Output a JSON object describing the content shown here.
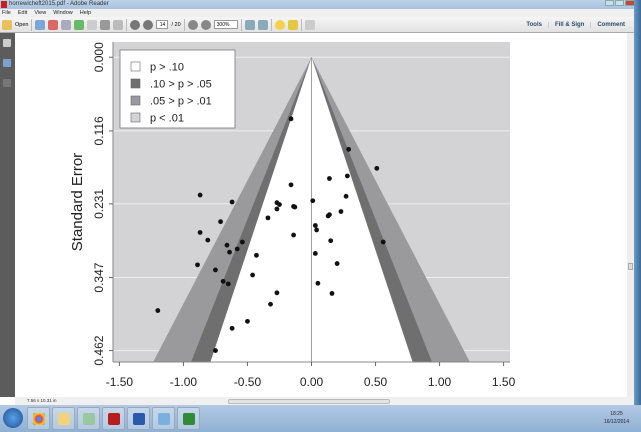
{
  "window": {
    "title": "horrewicheft2015.pdf - Adobe Reader"
  },
  "menu": [
    "File",
    "Edit",
    "View",
    "Window",
    "Help"
  ],
  "toolbar": {
    "open_label": "Open",
    "page_current": "14",
    "page_total": "/ 20",
    "zoom": "300%"
  },
  "right_tools": [
    "Tools",
    "Fill & Sign",
    "Comment"
  ],
  "status": {
    "page_size": "7.56 x 10.31 in"
  },
  "taskbar": {
    "time": "18:25",
    "date": "16/12/2014",
    "apps": [
      "chrome",
      "explorer",
      "library",
      "adobe-reader",
      "word",
      "paint",
      "excel"
    ]
  },
  "colors": {
    "panel": "#d3d3d5",
    "band_01": "#9a9a9c",
    "band_05": "#6f6f70",
    "inner": "#ffffff",
    "point": "#111111"
  },
  "chart_data": {
    "type": "scatter",
    "subtype": "contour-enhanced funnel plot",
    "xlabel": "",
    "ylabel": "Standard Error",
    "xlim": [
      -1.55,
      1.55
    ],
    "ylim": [
      0.48,
      -0.024
    ],
    "xticks": [
      "-1.50",
      "-1.00",
      "-0.50",
      "0.00",
      "0.50",
      "1.00",
      "1.50"
    ],
    "xtick_values": [
      -1.5,
      -1.0,
      -0.5,
      0,
      0.5,
      1.0,
      1.5
    ],
    "yticks": [
      "0.000",
      "0.116",
      "0.231",
      "0.347",
      "0.462"
    ],
    "ytick_values": [
      0,
      0.116,
      0.231,
      0.347,
      0.462
    ],
    "grid": true,
    "legend_position": "top-left",
    "legend": [
      {
        "label": "p > .10",
        "color": "#ffffff"
      },
      {
        "label": ".10 > p > .05",
        "color": "#6f6f70"
      },
      {
        "label": ".05 > p > .01",
        "color": "#9a9a9c"
      },
      {
        "label": "p < .01",
        "color": "#d3d3d5"
      }
    ],
    "contours_z": [
      1.645,
      1.96,
      2.576
    ],
    "points": [
      [
        -0.16,
        0.097
      ],
      [
        -0.16,
        0.201
      ],
      [
        -0.87,
        0.217
      ],
      [
        -0.62,
        0.228
      ],
      [
        -0.27,
        0.229
      ],
      [
        -0.25,
        0.232
      ],
      [
        -0.14,
        0.235
      ],
      [
        -0.13,
        0.236
      ],
      [
        -0.27,
        0.239
      ],
      [
        -0.34,
        0.253
      ],
      [
        -0.71,
        0.259
      ],
      [
        -0.87,
        0.276
      ],
      [
        -0.81,
        0.288
      ],
      [
        -0.54,
        0.291
      ],
      [
        -0.66,
        0.296
      ],
      [
        -0.58,
        0.302
      ],
      [
        -0.64,
        0.307
      ],
      [
        -0.14,
        0.28
      ],
      [
        -0.43,
        0.312
      ],
      [
        -0.89,
        0.327
      ],
      [
        -0.75,
        0.335
      ],
      [
        -0.46,
        0.343
      ],
      [
        -0.69,
        0.353
      ],
      [
        -0.65,
        0.357
      ],
      [
        -0.27,
        0.371
      ],
      [
        -0.32,
        0.389
      ],
      [
        -1.2,
        0.399
      ],
      [
        -0.5,
        0.416
      ],
      [
        -0.62,
        0.427
      ],
      [
        -0.75,
        0.462
      ],
      [
        0.29,
        0.145
      ],
      [
        0.51,
        0.175
      ],
      [
        0.14,
        0.191
      ],
      [
        0.28,
        0.187
      ],
      [
        0.27,
        0.219
      ],
      [
        0.01,
        0.226
      ],
      [
        0.23,
        0.243
      ],
      [
        0.13,
        0.25
      ],
      [
        0.14,
        0.248
      ],
      [
        0.03,
        0.265
      ],
      [
        0.04,
        0.272
      ],
      [
        0.15,
        0.289
      ],
      [
        0.56,
        0.291
      ],
      [
        0.03,
        0.309
      ],
      [
        0.2,
        0.325
      ],
      [
        0.05,
        0.356
      ],
      [
        0.16,
        0.372
      ]
    ]
  }
}
